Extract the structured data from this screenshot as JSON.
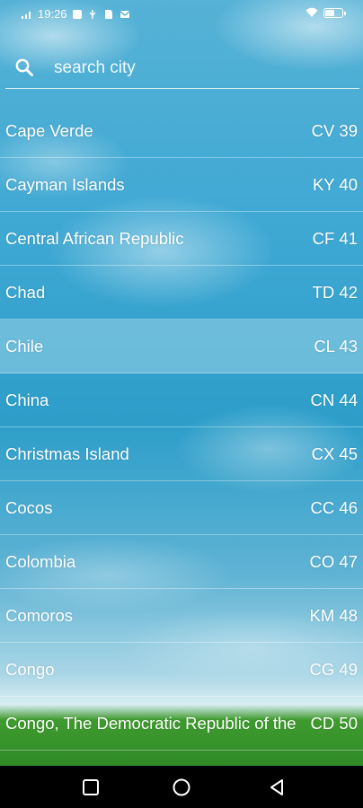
{
  "status_bar": {
    "time": "19:26",
    "battery_level": 0.6
  },
  "search": {
    "placeholder": "search city",
    "value": ""
  },
  "countries": [
    {
      "name": "Cape Verde",
      "code": "CV 39",
      "selected": false
    },
    {
      "name": "Cayman Islands",
      "code": "KY 40",
      "selected": false
    },
    {
      "name": "Central African Republic",
      "code": "CF 41",
      "selected": false
    },
    {
      "name": "Chad",
      "code": "TD 42",
      "selected": false
    },
    {
      "name": "Chile",
      "code": "CL 43",
      "selected": true
    },
    {
      "name": "China",
      "code": "CN 44",
      "selected": false
    },
    {
      "name": "Christmas Island",
      "code": "CX 45",
      "selected": false
    },
    {
      "name": "Cocos",
      "code": "CC 46",
      "selected": false
    },
    {
      "name": "Colombia",
      "code": "CO 47",
      "selected": false
    },
    {
      "name": "Comoros",
      "code": "KM 48",
      "selected": false
    },
    {
      "name": "Congo",
      "code": "CG 49",
      "selected": false
    },
    {
      "name": "Congo, The Democratic Republic of the",
      "code": "CD 50",
      "selected": false
    }
  ],
  "nav": {
    "icons": [
      "recents-square-icon",
      "home-circle-icon",
      "back-triangle-icon"
    ]
  }
}
